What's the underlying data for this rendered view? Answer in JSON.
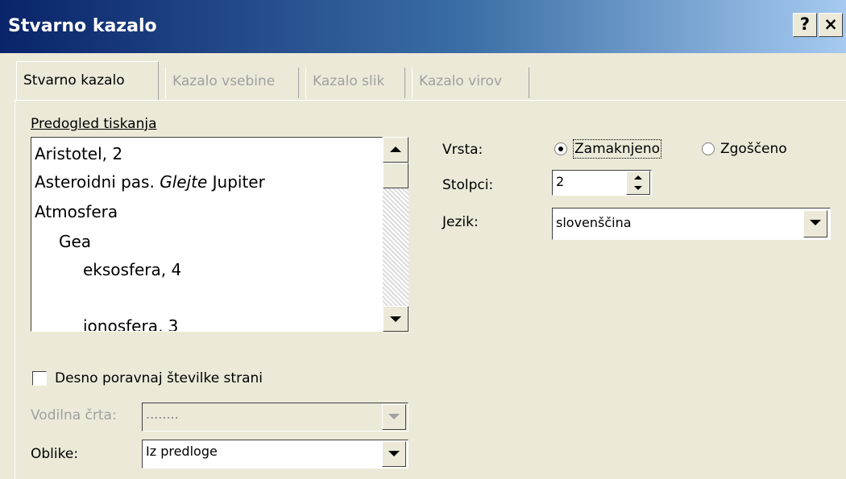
{
  "window": {
    "title": "Stvarno kazalo",
    "help_label": "?",
    "close_label": "×"
  },
  "tabs": [
    {
      "label": "Stvarno kazalo",
      "active": true
    },
    {
      "label": "Kazalo vsebine",
      "active": false
    },
    {
      "label": "Kazalo slik",
      "active": false
    },
    {
      "label": "Kazalo virov",
      "active": false
    }
  ],
  "preview": {
    "label": "Predogled tiskanja",
    "line1": "Aristotel, 2",
    "line2_a": "Asteroidni pas. ",
    "line2_b": "Glejte",
    "line2_c": " Jupiter",
    "line3": "Atmosfera",
    "line4": "Gea",
    "line5": "eksosfera, 4",
    "line6": "ionosfera, 3"
  },
  "type": {
    "label": "Vrsta:",
    "option_indented": "Zamaknjeno",
    "option_runin": "Zgoščeno",
    "selected": "Zamaknjeno"
  },
  "columns": {
    "label": "Stolpci:",
    "value": "2"
  },
  "language": {
    "label": "Jezik:",
    "value": "slovenščina"
  },
  "right_align": {
    "label": "Desno poravnaj številke strani",
    "checked": false
  },
  "tab_leader": {
    "label": "Vodilna črta:",
    "value": "........"
  },
  "formats": {
    "label": "Oblike:",
    "value": "Iz predloge"
  },
  "icons": [
    "help-icon",
    "close-icon",
    "scroll-up-icon",
    "scroll-down-icon",
    "spin-up-icon",
    "spin-down-icon",
    "dropdown-arrow-icon"
  ]
}
